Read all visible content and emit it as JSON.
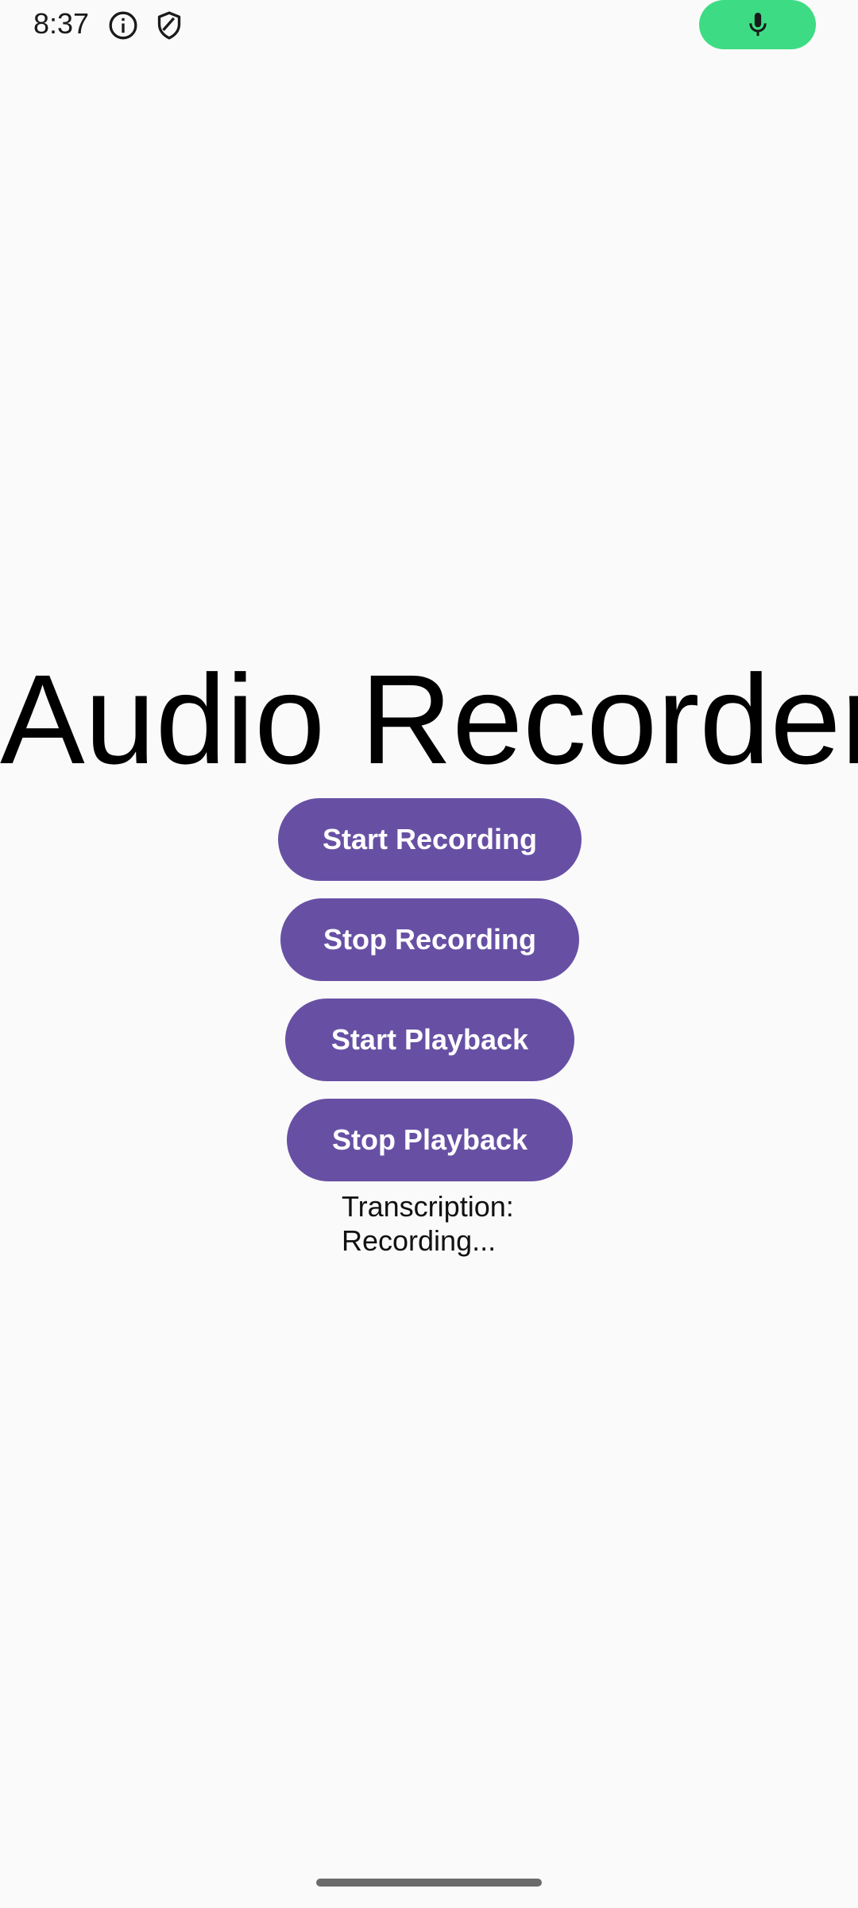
{
  "status_bar": {
    "time": "8:37",
    "icons": [
      "info-icon",
      "shield-icon"
    ],
    "mic_indicator": {
      "icon": "microphone-icon",
      "color": "#3ddc84"
    }
  },
  "app": {
    "title": "Audio Recorder",
    "accent_color": "#6750a4",
    "buttons": {
      "start_recording": "Start Recording",
      "stop_recording": "Stop Recording",
      "start_playback": "Start Playback",
      "stop_playback": "Stop Playback"
    },
    "transcription": {
      "label": "Transcription:",
      "value": "Recording..."
    }
  }
}
